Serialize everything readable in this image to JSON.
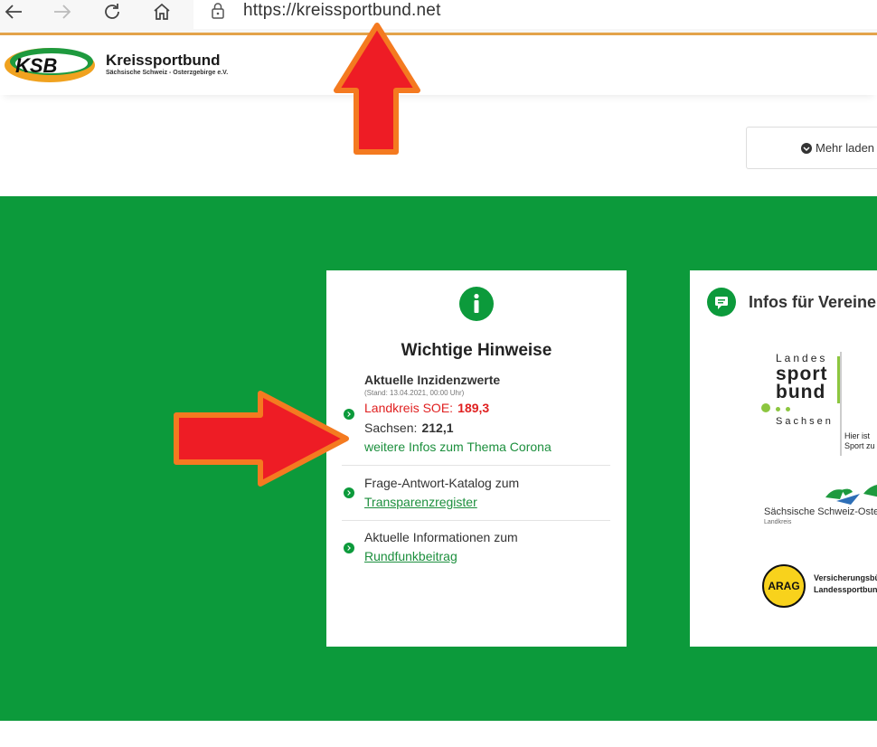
{
  "browser": {
    "url": "https://kreissportbund.net",
    "icons": [
      "back-arrow-icon",
      "forward-arrow-icon",
      "reload-icon",
      "home-icon",
      "lock-icon"
    ]
  },
  "header": {
    "logo_text": "KSB",
    "brand_name": "Kreissportbund",
    "brand_subtitle": "Sächsische Schweiz - Osterzgebirge e.V.",
    "more_button": "Mehr laden"
  },
  "colors": {
    "green": "#0c9a3b",
    "accent_orange": "#e3a34a",
    "annotation_red": "#ee1c25",
    "annotation_orange": "#f47a20"
  },
  "hinweise": {
    "title": "Wichtige Hinweise",
    "item1": {
      "title": "Aktuelle Inzidenzwerte",
      "stand": "(Stand: 13.04.2021, 00:00 Uhr)",
      "landkreis_label": "Landkreis SOE:",
      "landkreis_value": "189,3",
      "sachsen_label": "Sachsen:",
      "sachsen_value": "212,1",
      "link": "weitere Infos zum Thema Corona"
    },
    "item2": {
      "text": "Frage-Antwort-Katalog zum",
      "link": "Transparenzregister"
    },
    "item3": {
      "text": "Aktuelle Informationen zum",
      "link": "Rundfunkbeitrag"
    }
  },
  "vereine": {
    "title": "Infos für Vereine",
    "lsb_logo": {
      "line1": "Landes",
      "line2": "sport",
      "line3": "bund",
      "line4": "Sachsen",
      "tag1": "Hier ist",
      "tag2": "Sport zu"
    },
    "landkreis_logo": {
      "name": "Sächsische Schweiz-Oster",
      "sub": "Landkreis"
    },
    "arag_logo": {
      "badge": "ARAG",
      "line1": "Versicherungsbü",
      "line2": "Landessportbund"
    }
  }
}
